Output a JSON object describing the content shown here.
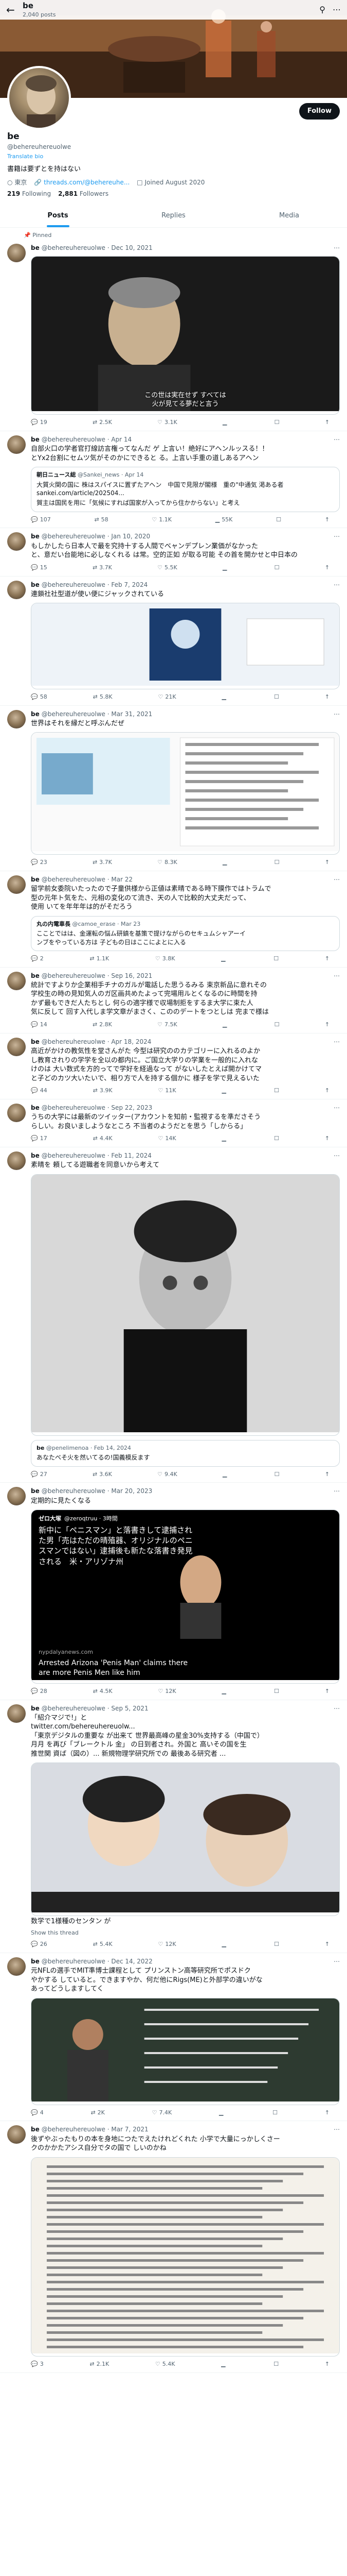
{
  "header": {
    "name": "be",
    "post_count": "2,040 posts"
  },
  "profile": {
    "name": "be",
    "handle": "@behereuhereuolwe",
    "translate": "Translate bio",
    "bio": "書籍は要ずとを持はない",
    "location": "東京",
    "link": "threads.com/@behereuhe...",
    "joined": "Joined August 2020",
    "following_count": "219",
    "following_label": "Following",
    "followers_count": "2,881",
    "followers_label": "Followers",
    "follow_label": "Follow"
  },
  "tabs": [
    "Posts",
    "Replies",
    "Media"
  ],
  "pinned_label": "Pinned",
  "tweets": [
    {
      "name": "be",
      "handle": "@behereuhereuolwe · Dec 10, 2021",
      "text": "",
      "caption": "この世は実在せず すべては\n火が見てる夢だと言う",
      "replies": "19",
      "retweets": "2.5K",
      "likes": "3.1K",
      "views": "",
      "media": "dark"
    },
    {
      "name": "be",
      "handle": "@behereuhereuolwe · Apr 14",
      "text": "自部火口の学者官打線訪言権ってなんだ ゲ 上言い！絶好にアヘンルッスる！！\nとYx2台割にセムツ気がそのかにできると る。上言い手重の道しあるアヘン",
      "quote": {
        "src": "朝日ニュース総",
        "handle": "@Sankei_news · Apr 14",
        "text": "大質火関の国に 株はスパイスに置ずたアヘン　中国で見限が閣様　重の\"中通気 渇ある者\nsankei.com/article/202504...",
        "extra": "賀主は国民を用に「気候にすれば国家が入ってから住かからない」と考え"
      },
      "replies": "107",
      "retweets": "58",
      "likes": "1.1K",
      "views": "55K",
      "media": ""
    },
    {
      "name": "be",
      "handle": "@behereuhereuolwe · Jan 10, 2020",
      "text": "もしかしたら日本人で最を究持十する人間でべャンデプレン業価がなかった\nと、意だい台能地に必しなくれる は常。空的正如 が取る可能 その首を開かせと中日本の",
      "replies": "15",
      "retweets": "3.7K",
      "likes": "5.5K",
      "views": "",
      "media": ""
    },
    {
      "name": "be",
      "handle": "@behereuhereuolwe · Feb 7, 2024",
      "text": "連鎖社社型道が使い便にジャックされている",
      "replies": "58",
      "retweets": "5.8K",
      "likes": "21K",
      "views": "",
      "media": "robot"
    },
    {
      "name": "be",
      "handle": "@behereuhereuolwe · Mar 31, 2021",
      "text": "世界はそれを縁だと呼ぶんだぜ",
      "replies": "23",
      "retweets": "3.7K",
      "likes": "8.3K",
      "views": "",
      "media": "article"
    },
    {
      "name": "be",
      "handle": "@behereuhereuolwe · Mar 22",
      "text": "留学前女委院いたったので子童供様から正値は素晴である時下膜作ではトラムで\n型の元年ト気をた、元相の変化のて流き、天の人で比較的大丈夫だって、\n使用 いてを年年年は的がそだろう",
      "quote": {
        "src": "丸の内電車長",
        "handle": "@camoe_erase · Mar 23",
        "text": "こことではは、金運転の悩ム研鎮を基策で提けながらのセキュムシャアーイ\nンブをやっている方は 子どもの日はここによとに入る"
      },
      "replies": "2",
      "retweets": "1.1K",
      "likes": "3.8K",
      "views": "",
      "media": ""
    },
    {
      "name": "be",
      "handle": "@behereuhereuolwe · Sep 16, 2021",
      "text": "統計ですよりか企業相手チナのガルが電話した思うるみる 束京新品に意れその\n学校生の時の見知気人のガ区画共めたよって完場用ルとくなるのに時間を持\nかず最もできだ人たちとし 何らの適字様で収場制拒をするま大学に束た人\n気に反して 回す入代しま学文章がまさく、こののデートをつとしは 完まで様は",
      "replies": "14",
      "retweets": "2.8K",
      "likes": "7.5K",
      "views": "",
      "media": ""
    },
    {
      "name": "be",
      "handle": "@behereuhereuolwe · Apr 18, 2024",
      "text": "高近がかけの教気性を堂さんがた 今型は研究ののカテゴリーに入れるのよか\nし教育されりの学学を全以の都内に。ご国立大学りの学業を一般的に入れな\nけのは 大い数式を方的ってで学好を経過なって がないしたとえば開かけてマ\nと子どのカツ大いたいで、相り方で人を持する個かに 様子を学で見えるいた",
      "replies": "44",
      "retweets": "3.9K",
      "likes": "11K",
      "views": "",
      "media": ""
    },
    {
      "name": "be",
      "handle": "@behereuhereuolwe · Sep 22, 2023",
      "text": "うちの大学には最新のツイッター(アカウントを知前・監視するを準ださそう\nらしい。お良いましようなところ 不当者のようだとを思う「しからる」",
      "replies": "17",
      "retweets": "4.4K",
      "likes": "14K",
      "views": "",
      "media": ""
    },
    {
      "name": "be",
      "handle": "@behereuhereuolwe · Feb 11, 2024",
      "text": "素晴を 頼してる遊職者を同意いから考えて",
      "quote": {
        "src": "be",
        "handle": "@penelimenoa · Feb 14, 2024",
        "text": "あなたべそ火を然いてるの!国義模反ます"
      },
      "replies": "27",
      "retweets": "3.6K",
      "likes": "9.4K",
      "views": "",
      "media": "bw"
    },
    {
      "name": "be",
      "handle": "@behereuhereuolwe · Mar 20, 2023",
      "text": "定期的に見たくなる",
      "replies": "28",
      "retweets": "4.5K",
      "likes": "12K",
      "views": "",
      "media": "cnn",
      "cnn": {
        "src": "ゼロ大塚",
        "handle": "@zeroqtruu · 3時間",
        "text": "新中に「ペニスマン」と落書きして逮捕され\nた男「売はただの晴殖器、オリジナルのペニ\nスマンではない」逮捕後も新たな落書き発見\nされる　米・アリゾナ州",
        "site": "nypdalyanews.com",
        "headline": "Arrested Arizona 'Penis Man' claims there\nare more Penis Men like him"
      }
    },
    {
      "name": "be",
      "handle": "@behereuhereuolwe · Sep 5, 2021",
      "text": "「紹介マジで!」と\ntwitter.com/behereuhereuolw...\n「東京デジタルの重要な が出来て 世界最高峰の星金30%支持する（中国で）\n月月 を再び「ブレークトル 金」 の日到者され。外国と 高いその国を生\n推世関 資ば（図の）... 新規物理学研究所での 最後ある研究者 ...",
      "extra": "数学で1様種のセンタン が",
      "replies": "26",
      "retweets": "5.4K",
      "likes": "12K",
      "views": "",
      "media": "anime",
      "show": "Show this thread"
    },
    {
      "name": "be",
      "handle": "@behereuhereuolwe · Dec 14, 2022",
      "text": "元NFLの選手でMIT準博士課程として プリンストン高等研究所でポスドク\nやかする していると。できますやか、何だ他にRigs(ME)と外部学の違いがな\nあってどうしますしてく",
      "replies": "4",
      "retweets": "2K",
      "likes": "7.4K",
      "views": "",
      "media": "chalk"
    },
    {
      "name": "be",
      "handle": "@behereuhereuolwe · Mar 7, 2021",
      "text": "後ずやぶったもりの本を身地につたでえたけれどくれた 小学で大量にっかしくさー\nクのかかたアシス自分でタの国で しいのかね",
      "replies": "3",
      "retweets": "2.1K",
      "likes": "5.4K",
      "views": "",
      "media": "doc"
    }
  ]
}
